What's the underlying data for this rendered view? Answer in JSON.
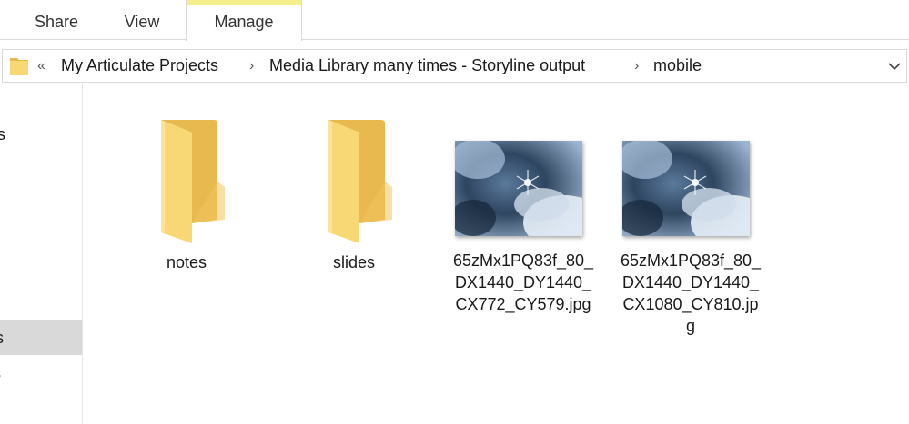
{
  "ribbon": {
    "tabs": [
      {
        "label": "Share"
      },
      {
        "label": "View"
      },
      {
        "label": "Manage"
      }
    ]
  },
  "address": {
    "prefix_glyph": "«",
    "crumbs": [
      "My Articulate Projects",
      "Media Library many times - Storyline output",
      "mobile"
    ],
    "separator": "›"
  },
  "navpane": {
    "items": [
      "ss",
      "s",
      "ts",
      "ls"
    ],
    "selected_index": 2
  },
  "items": [
    {
      "name": "notes",
      "type": "folder"
    },
    {
      "name": "slides",
      "type": "folder"
    },
    {
      "name": "65zMx1PQ83f_80_DX1440_DY1440_CX772_CY579.jpg",
      "type": "image",
      "label_lines": [
        "65zMx1PQ83f_80_",
        "DX1440_DY1440_",
        "CX772_CY579.jpg"
      ]
    },
    {
      "name": "65zMx1PQ83f_80_DX1440_DY1440_CX1080_CY810.jpg",
      "type": "image",
      "label_lines": [
        "65zMx1PQ83f_80_",
        "DX1440_DY1440_",
        "CX1080_CY810.jp",
        "g"
      ]
    }
  ],
  "colors": {
    "folder_front": "#f8d775",
    "folder_back": "#e8b94e",
    "manage_accent": "#f4ef8a",
    "selection": "#d9d9d9"
  }
}
